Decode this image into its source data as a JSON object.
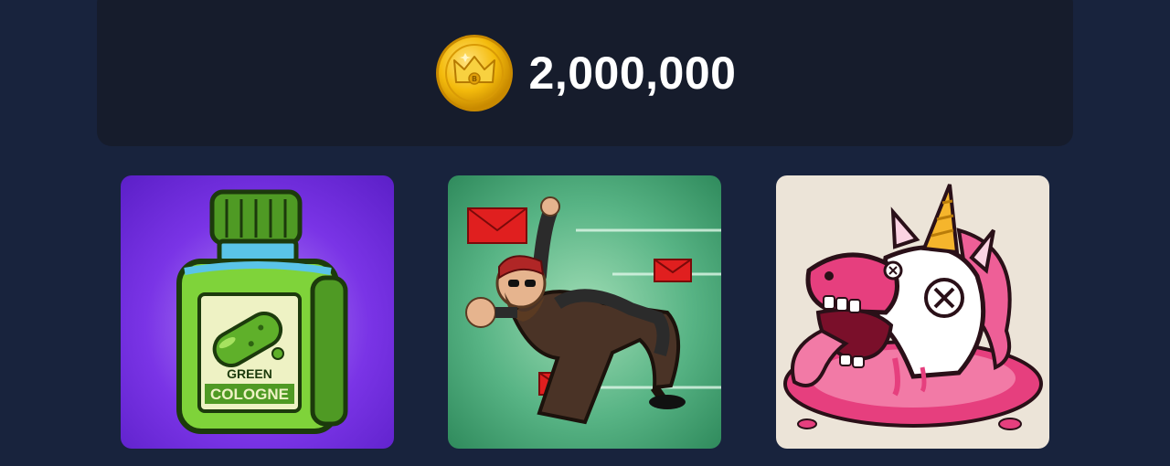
{
  "balance": {
    "amount": "2,000,000",
    "coin_icon": "crown-coin-icon",
    "coin_color": "#f2b705"
  },
  "cards": [
    {
      "name": "green-cologne",
      "icon": "green-cologne-bottle-icon",
      "label_line1": "GREEN",
      "label_line2": "COLOGNE",
      "background": "#7a34e6"
    },
    {
      "name": "email-dodger",
      "icon": "dodging-man-envelopes-icon",
      "background": "#58b485"
    },
    {
      "name": "melting-unicorn",
      "icon": "melting-unicorn-icon",
      "background": "#ece4d8"
    }
  ]
}
